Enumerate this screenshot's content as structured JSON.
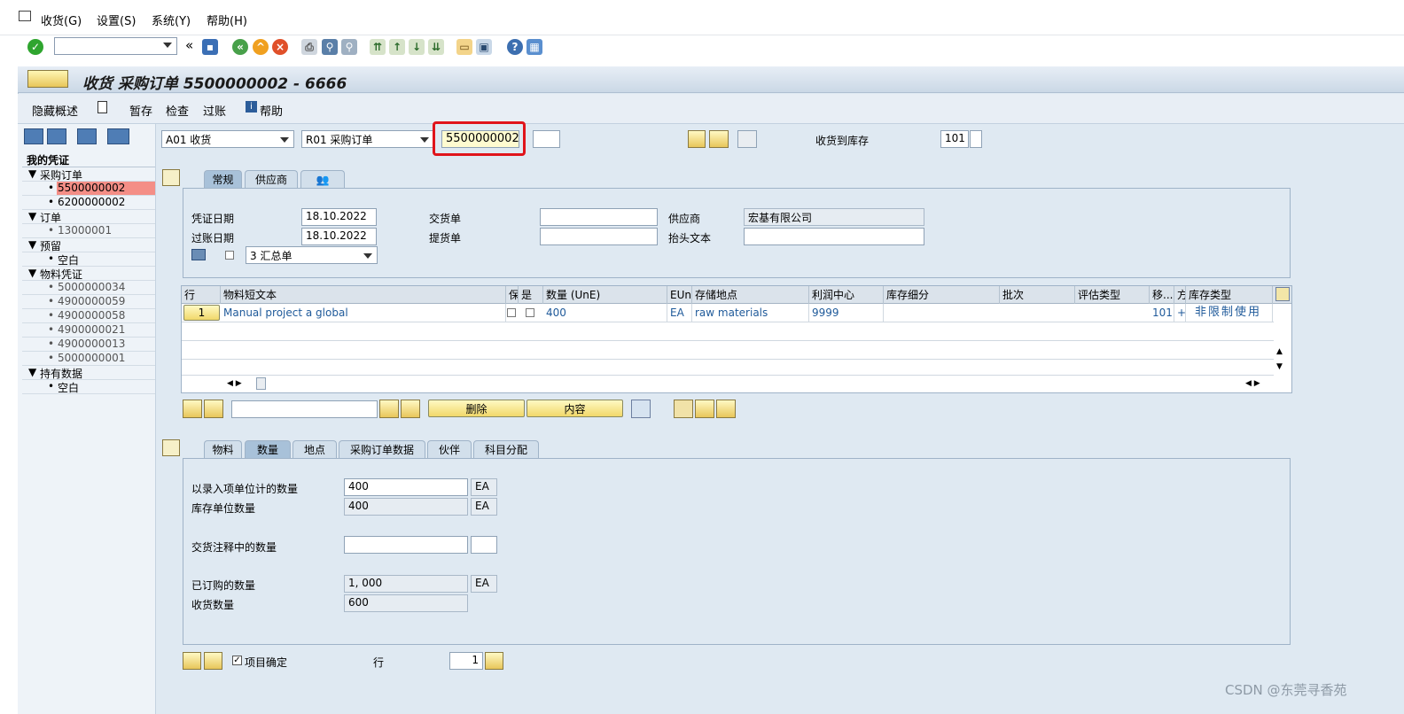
{
  "menu": {
    "items": [
      "收货(G)",
      "设置(S)",
      "系统(Y)",
      "帮助(H)"
    ]
  },
  "toolbar": {
    "command_value": ""
  },
  "title": "收货 采购订单 5500000002 - 6666",
  "appbar": {
    "hide_overview": "隐藏概述",
    "hold": "暂存",
    "check": "检查",
    "post": "过账",
    "help": "帮助"
  },
  "sidebar": {
    "header": "我的凭证",
    "groups": [
      {
        "label": "采购订单",
        "items": [
          "5500000002",
          "6200000002"
        ]
      },
      {
        "label": "订单",
        "items": [
          "13000001"
        ]
      },
      {
        "label": "预留",
        "items": [
          "空白"
        ]
      },
      {
        "label": "物料凭证",
        "items": [
          "5000000034",
          "4900000059",
          "4900000058",
          "4900000021",
          "4900000013",
          "5000000001"
        ]
      },
      {
        "label": "持有数据",
        "items": [
          "空白"
        ]
      }
    ]
  },
  "header": {
    "action": "A01 收货",
    "ref_doc": "R01 采购订单",
    "po_number": "5500000002",
    "goods_receipt_label": "收货到库存",
    "movement_type": "101"
  },
  "header_tabs": [
    "常规",
    "供应商"
  ],
  "general": {
    "doc_date_label": "凭证日期",
    "doc_date": "18.10.2022",
    "post_date_label": "过账日期",
    "post_date": "18.10.2022",
    "delivery_note_label": "交货单",
    "delivery_note": "",
    "bill_of_lading_label": "提货单",
    "bill_of_lading": "",
    "vendor_label": "供应商",
    "vendor": "宏基有限公司",
    "header_text_label": "抬头文本",
    "header_text": "",
    "print_option": "3 汇总单"
  },
  "grid": {
    "columns": [
      "行",
      "物料短文本",
      "保",
      "是",
      "数量 (UnE)",
      "EUn",
      "存储地点",
      "利润中心",
      "库存细分",
      "批次",
      "评估类型",
      "移...",
      "方",
      "库存类型"
    ],
    "rows": [
      {
        "line": "1",
        "text": "Manual project a global",
        "qty": "400",
        "eun": "EA",
        "sloc": "raw materials",
        "profit": "9999",
        "mvt": "101",
        "dir": "+",
        "stock_type": "非限制使用"
      }
    ]
  },
  "grid_actions": {
    "delete": "删除",
    "content": "内容",
    "search_value": ""
  },
  "item_tabs": [
    "物料",
    "数量",
    "地点",
    "采购订单数据",
    "伙伴",
    "科目分配"
  ],
  "quantity": {
    "entry_label": "以录入项单位计的数量",
    "entry_qty": "400",
    "entry_unit": "EA",
    "stock_label": "库存单位数量",
    "stock_qty": "400",
    "stock_unit": "EA",
    "delivery_label": "交货注释中的数量",
    "delivery_qty": "",
    "delivery_unit": "",
    "ordered_label": "已订购的数量",
    "ordered_qty": "1, 000",
    "ordered_unit": "EA",
    "received_label": "收货数量",
    "received_qty": "600"
  },
  "footer": {
    "item_ok_label": "项目确定",
    "line_label": "行",
    "line_value": "1"
  },
  "watermark": "CSDN @东莞寻香苑",
  "colors": {
    "highlight_box": "#e0141b",
    "selected_item": "#f48e86",
    "yellow_button": "#f1d86a"
  }
}
